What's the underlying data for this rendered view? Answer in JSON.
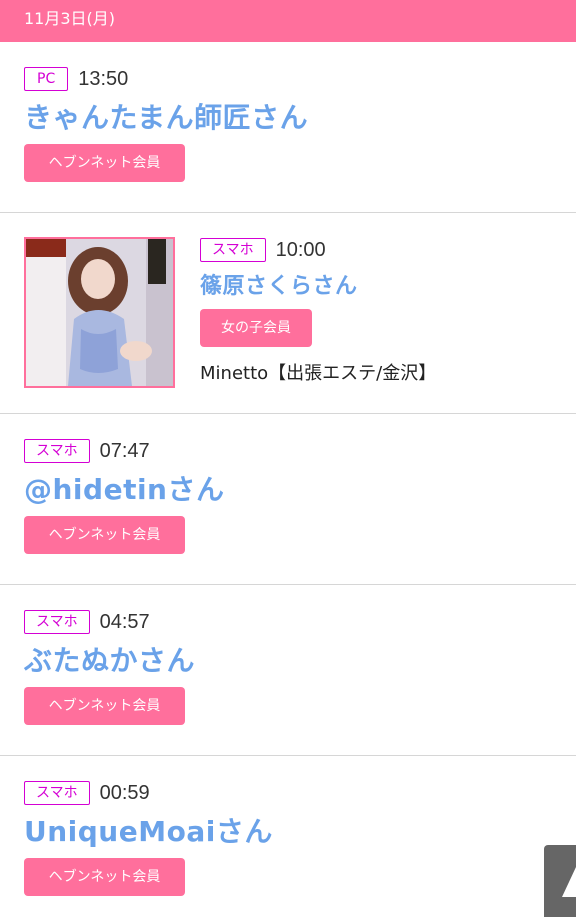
{
  "date_header": "11月3日(月)",
  "entries": [
    {
      "device": "PC",
      "time": "13:50",
      "name": "きゃんたまん師匠さん",
      "badge": "ヘブンネット会員"
    },
    {
      "device": "スマホ",
      "time": "10:00",
      "name": "篠原さくらさん",
      "badge": "女の子会員",
      "shop": "Minetto【出張エステ/金沢】"
    },
    {
      "device": "スマホ",
      "time": "07:47",
      "name": "@hidetinさん",
      "badge": "ヘブンネット会員"
    },
    {
      "device": "スマホ",
      "time": "04:57",
      "name": "ぶたぬかさん",
      "badge": "ヘブンネット会員"
    },
    {
      "device": "スマホ",
      "time": "00:59",
      "name": "UniqueMoaiさん",
      "badge": "ヘブンネット会員"
    }
  ],
  "colors": {
    "accent": "#ff6f9c",
    "device_tag": "#d400d4",
    "name_link": "#6aa2e9"
  },
  "icons": {
    "scroll_top": "triangle-up-icon"
  }
}
